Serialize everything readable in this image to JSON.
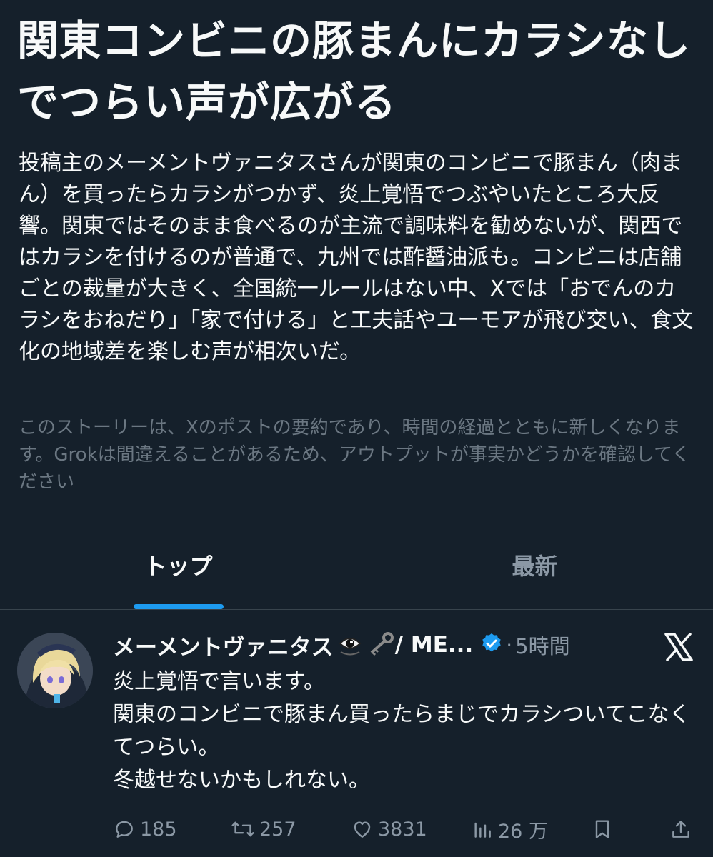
{
  "story": {
    "title": "関東コンビニの豚まんにカラシなしでつらい声が広がる",
    "summary": "投稿主のメーメントヴァニタスさんが関東のコンビニで豚まん（肉まん）を買ったらカラシがつかず、炎上覚悟でつぶやいたところ大反響。関東ではそのまま食べるのが主流で調味料を勧めないが、関西ではカラシを付けるのが普通で、九州では酢醤油派も。コンビニは店舗ごとの裁量が大きく、全国統一ルールはない中、Xでは「おでんのカラシをおねだり」「家で付ける」と工夫話やユーモアが飛び交い、食文化の地域差を楽しむ声が相次いだ。",
    "disclaimer": "このストーリーは、Xのポストの要約であり、時間の経過とともに新しくなります。Grokは間違えることがあるため、アウトプットが事実かどうかを確認してください"
  },
  "tabs": [
    {
      "label": "トップ",
      "active": true
    },
    {
      "label": "最新",
      "active": false
    }
  ],
  "post": {
    "author": "メーメントヴァニタス",
    "handle_suffix": " / ME...",
    "separator": "·",
    "time": "5時間",
    "body_lines": [
      "炎上覚悟で言います。",
      "関東のコンビニで豚まん買ったらまじでカラシついてこなくてつらい。",
      "冬越せないかもしれない。"
    ],
    "actions": {
      "replies": "185",
      "reposts": "257",
      "likes": "3831",
      "views": "26 万"
    }
  },
  "colors": {
    "background": "#15202b",
    "accent": "#1d9bf0",
    "text": "#f7f9f9",
    "muted": "#8b98a5"
  }
}
